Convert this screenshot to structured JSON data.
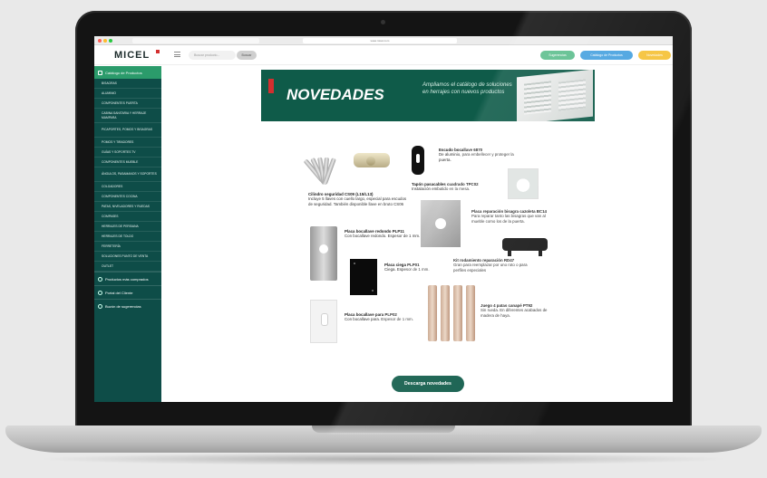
{
  "browser": {
    "url": "www.micel.com"
  },
  "header": {
    "logo": "MICEL",
    "search_placeholder": "Buscar producto...",
    "search_button": "Buscar",
    "btn_green": "Sugerencias",
    "btn_blue": "Catálogo de Productos",
    "btn_yellow": "Novedades"
  },
  "sidebar": {
    "top_label": "Catálogo de Productos",
    "items": [
      "Bisagras",
      "Aluminio",
      "Componentes puerta",
      "Cabina sanitaria y herraje mampara",
      "Picaportes, pomos y bisagras",
      "Pomos y tiradores",
      "Guías y soportes TV",
      "Componentes mueble",
      "Ángulos, pasamanos y soportes",
      "Colgadores",
      "Componentes cocina",
      "Patas, niveladores y ruedas",
      "Compases",
      "Herrajes de persiana",
      "Herrajes de toldo",
      "Ferretería",
      "Soluciones punto de venta",
      "Outlet"
    ],
    "bottom": [
      "Productos más comprados",
      "Portal del Cliente",
      "Buzón de sugerencias"
    ]
  },
  "banner": {
    "title": "NOVEDADES",
    "text": "Ampliamos el catálogo de soluciones en herrajes con nuevos productos"
  },
  "products": [
    {
      "title": "Cilindro seguridad CS09 (L15/L13)",
      "desc": "Incluye 5 llaves con cuello largo, especial para escudos de seguridad. También disponible llave en bruto CS06"
    },
    {
      "title": "Escudo bocallave 6870",
      "desc": "De aluminio, para embellecer y proteger la puerta."
    },
    {
      "title": "Tapón pasacables cuadrado TPC02",
      "desc": "Instalación embutido en la mesa."
    },
    {
      "title": "Placa reparación bisagra cazoleta BC14",
      "desc": "Para reparar tanto las bisagras que van al mueble como los de la puerta."
    },
    {
      "title": "Placa bocallave redondo PLP11",
      "desc": "Con bocallave redondo. Espesor de 1 mm."
    },
    {
      "title": "Kit rodamiento reparación RD47",
      "desc": "Gran para reemplazar por uno roto o para perfiles especiales"
    },
    {
      "title": "Placa ciega PLP01",
      "desc": "Ciega. Espesor de 1 mm."
    },
    {
      "title": "Juego 4 patas canapé PT92",
      "desc": "Sin rueda. En diferentes acabados de madera de haya."
    },
    {
      "title": "Placa bocallave para PLP02",
      "desc": "Con bocallave para. Espesor de 1 mm."
    }
  ],
  "download_button": "Descarga novedades",
  "colors": {
    "primary": "#0f5b49",
    "sidebar": "#0e4d48",
    "accent_green": "#2b9b6b",
    "brand_red": "#d32f2f"
  }
}
